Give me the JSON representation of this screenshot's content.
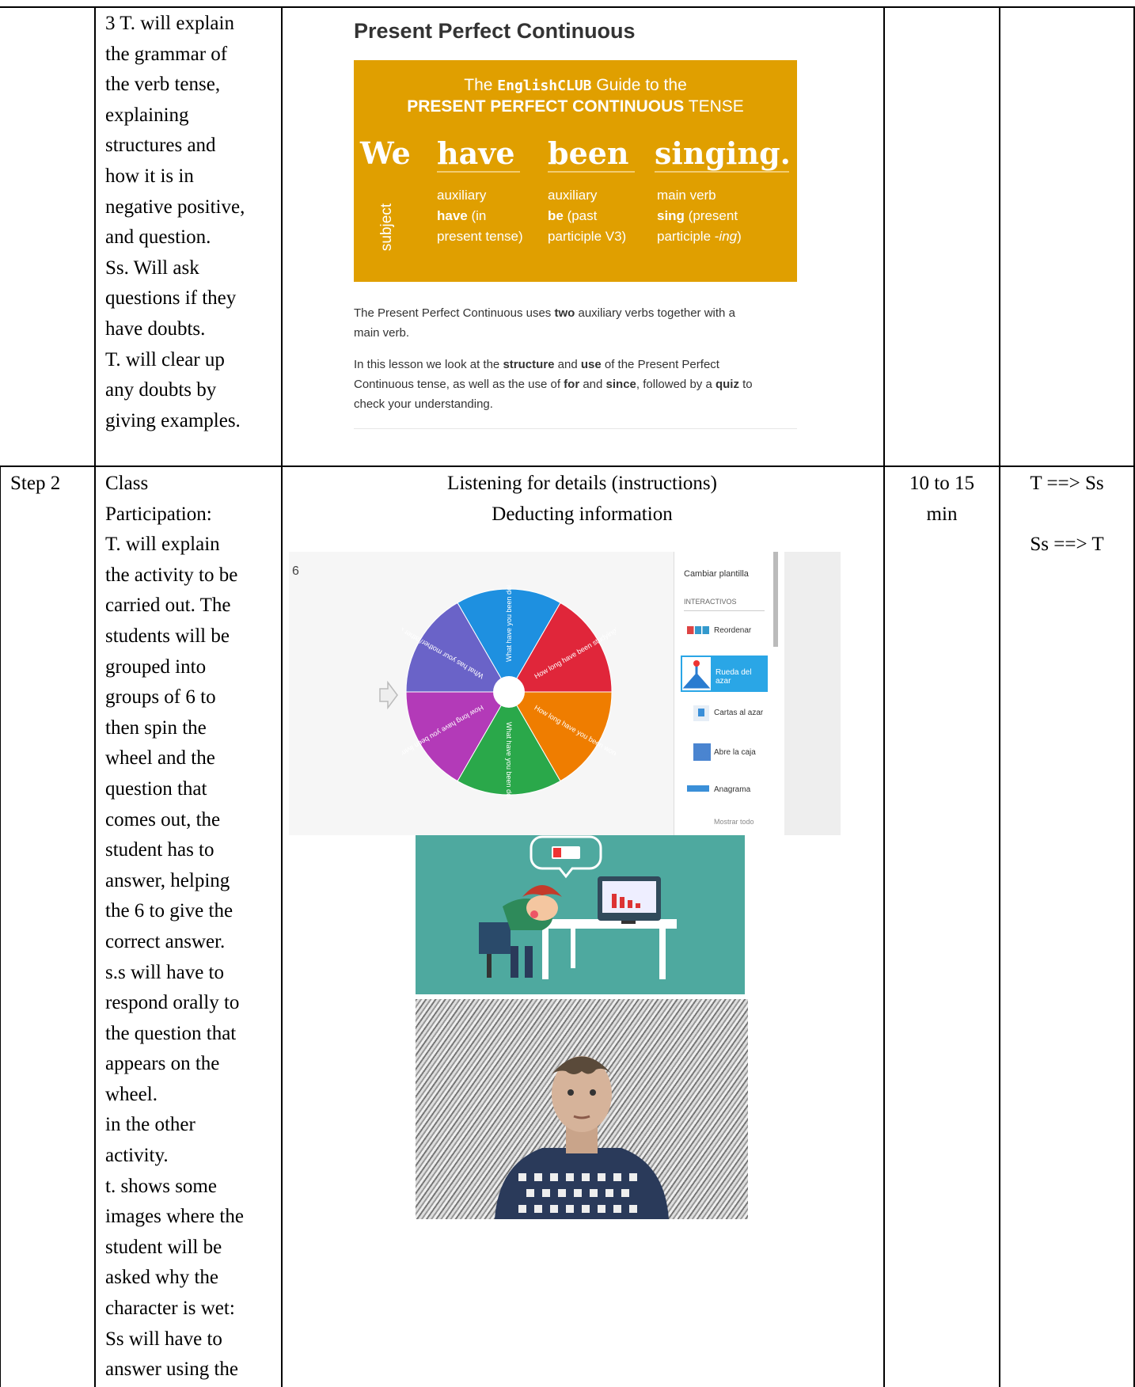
{
  "table": {
    "row1": {
      "procedure_lines": [
        "3 T. will explain",
        "the grammar of",
        "the verb tense,",
        "explaining",
        "structures and",
        "how it is in",
        "negative positive,",
        "and question.",
        "Ss. Will ask",
        "questions if they",
        "have doubts.",
        "T. will clear up",
        "any doubts by",
        "giving examples."
      ]
    },
    "row2": {
      "step": "Step 2",
      "procedure_lines": [
        "Class",
        "Participation:",
        "T. will explain",
        "the activity to be",
        "carried out. The",
        "students will be",
        "grouped into",
        "groups of 6 to",
        "then spin the",
        "wheel and the",
        "question that",
        "comes out, the",
        "student has to",
        "answer, helping",
        "the 6 to give the",
        "correct answer.",
        "s.s will have to",
        "respond orally to",
        "the question that",
        "appears on the",
        "wheel.",
        "in the other",
        "activity.",
        "t. shows some",
        "images where the",
        "student will be",
        "asked why the",
        "character is wet:",
        "Ss will have to",
        "answer using the"
      ],
      "skills_line1": "Listening for details (instructions)",
      "skills_line2": "Deducting information",
      "time_line1": "10 to 15",
      "time_line2": "min",
      "interaction1": "T ==> Ss",
      "interaction2": "Ss ==> T"
    }
  },
  "lesson_page": {
    "heading": "Present Perfect Continuous",
    "banner": {
      "line1_pre": "The ",
      "brand": "EnglishCLUB",
      "line1_post": " Guide to the",
      "line2_bold": "PRESENT PERFECT CONTINUOUS",
      "line2_rest": " TENSE",
      "words": [
        "We",
        "have",
        "been",
        "singing."
      ],
      "subject_label": "subject",
      "col1": {
        "l1": "auxiliary",
        "l2_bold": "have",
        "l2_rest": " (in",
        "l3": "present tense)"
      },
      "col2": {
        "l1": "auxiliary",
        "l2_bold": "be",
        "l2_rest": " (past",
        "l3": "participle V3)"
      },
      "col3": {
        "l1": "main verb",
        "l2_bold": "sing",
        "l2_rest": " (present",
        "l3_pre": "participle -",
        "l3_it": "ing",
        "l3_post": ")"
      }
    },
    "para1": {
      "a": "The Present Perfect Continuous uses ",
      "b": "two",
      "c": " auxiliary verbs together with a",
      "d": "main verb."
    },
    "para2": {
      "a": "In this lesson we look at the ",
      "b": "structure",
      "c": " and ",
      "d": "use",
      "e": " of the Present Perfect",
      "f": "Continuous tense, as well as the use of ",
      "g": "for",
      "h": " and ",
      "i": "since",
      "j": ", followed by a ",
      "k": "quiz",
      "l": " to",
      "m": "check your understanding."
    }
  },
  "wheel_app": {
    "corner_number": "6",
    "menu_title": "Cambiar plantilla",
    "section": "INTERACTIVOS",
    "items": [
      "Reordenar",
      "Rueda del azar",
      "Cartas al azar",
      "Abre la caja",
      "Anagrama"
    ],
    "show_all": "Mostrar todo",
    "segments": [
      {
        "text": "What have you been doing recently?",
        "color": "#1e90e0"
      },
      {
        "text": "How long have been studying?",
        "color": "#e0263a"
      },
      {
        "text": "How long have you been working?",
        "color": "#ef7d00"
      },
      {
        "text": "What have you been doing lately?",
        "color": "#2aa84a"
      },
      {
        "text": "How long have you been living here?",
        "color": "#b33ab8"
      },
      {
        "text": "What has your mother/father been doing lately?",
        "color": "#6a63c8"
      }
    ]
  }
}
